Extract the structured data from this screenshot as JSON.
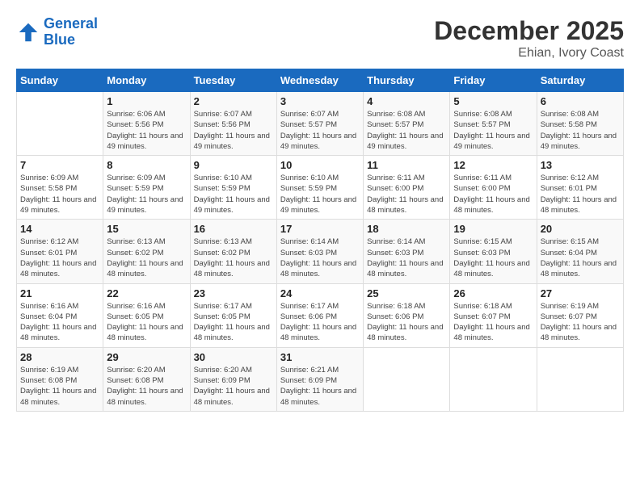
{
  "header": {
    "logo_line1": "General",
    "logo_line2": "Blue",
    "month": "December 2025",
    "location": "Ehian, Ivory Coast"
  },
  "days_of_week": [
    "Sunday",
    "Monday",
    "Tuesday",
    "Wednesday",
    "Thursday",
    "Friday",
    "Saturday"
  ],
  "weeks": [
    [
      {
        "day": "",
        "sunrise": "",
        "sunset": "",
        "daylight": ""
      },
      {
        "day": "1",
        "sunrise": "6:06 AM",
        "sunset": "5:56 PM",
        "daylight": "11 hours and 49 minutes."
      },
      {
        "day": "2",
        "sunrise": "6:07 AM",
        "sunset": "5:56 PM",
        "daylight": "11 hours and 49 minutes."
      },
      {
        "day": "3",
        "sunrise": "6:07 AM",
        "sunset": "5:57 PM",
        "daylight": "11 hours and 49 minutes."
      },
      {
        "day": "4",
        "sunrise": "6:08 AM",
        "sunset": "5:57 PM",
        "daylight": "11 hours and 49 minutes."
      },
      {
        "day": "5",
        "sunrise": "6:08 AM",
        "sunset": "5:57 PM",
        "daylight": "11 hours and 49 minutes."
      },
      {
        "day": "6",
        "sunrise": "6:08 AM",
        "sunset": "5:58 PM",
        "daylight": "11 hours and 49 minutes."
      }
    ],
    [
      {
        "day": "7",
        "sunrise": "6:09 AM",
        "sunset": "5:58 PM",
        "daylight": "11 hours and 49 minutes."
      },
      {
        "day": "8",
        "sunrise": "6:09 AM",
        "sunset": "5:59 PM",
        "daylight": "11 hours and 49 minutes."
      },
      {
        "day": "9",
        "sunrise": "6:10 AM",
        "sunset": "5:59 PM",
        "daylight": "11 hours and 49 minutes."
      },
      {
        "day": "10",
        "sunrise": "6:10 AM",
        "sunset": "5:59 PM",
        "daylight": "11 hours and 49 minutes."
      },
      {
        "day": "11",
        "sunrise": "6:11 AM",
        "sunset": "6:00 PM",
        "daylight": "11 hours and 48 minutes."
      },
      {
        "day": "12",
        "sunrise": "6:11 AM",
        "sunset": "6:00 PM",
        "daylight": "11 hours and 48 minutes."
      },
      {
        "day": "13",
        "sunrise": "6:12 AM",
        "sunset": "6:01 PM",
        "daylight": "11 hours and 48 minutes."
      }
    ],
    [
      {
        "day": "14",
        "sunrise": "6:12 AM",
        "sunset": "6:01 PM",
        "daylight": "11 hours and 48 minutes."
      },
      {
        "day": "15",
        "sunrise": "6:13 AM",
        "sunset": "6:02 PM",
        "daylight": "11 hours and 48 minutes."
      },
      {
        "day": "16",
        "sunrise": "6:13 AM",
        "sunset": "6:02 PM",
        "daylight": "11 hours and 48 minutes."
      },
      {
        "day": "17",
        "sunrise": "6:14 AM",
        "sunset": "6:03 PM",
        "daylight": "11 hours and 48 minutes."
      },
      {
        "day": "18",
        "sunrise": "6:14 AM",
        "sunset": "6:03 PM",
        "daylight": "11 hours and 48 minutes."
      },
      {
        "day": "19",
        "sunrise": "6:15 AM",
        "sunset": "6:03 PM",
        "daylight": "11 hours and 48 minutes."
      },
      {
        "day": "20",
        "sunrise": "6:15 AM",
        "sunset": "6:04 PM",
        "daylight": "11 hours and 48 minutes."
      }
    ],
    [
      {
        "day": "21",
        "sunrise": "6:16 AM",
        "sunset": "6:04 PM",
        "daylight": "11 hours and 48 minutes."
      },
      {
        "day": "22",
        "sunrise": "6:16 AM",
        "sunset": "6:05 PM",
        "daylight": "11 hours and 48 minutes."
      },
      {
        "day": "23",
        "sunrise": "6:17 AM",
        "sunset": "6:05 PM",
        "daylight": "11 hours and 48 minutes."
      },
      {
        "day": "24",
        "sunrise": "6:17 AM",
        "sunset": "6:06 PM",
        "daylight": "11 hours and 48 minutes."
      },
      {
        "day": "25",
        "sunrise": "6:18 AM",
        "sunset": "6:06 PM",
        "daylight": "11 hours and 48 minutes."
      },
      {
        "day": "26",
        "sunrise": "6:18 AM",
        "sunset": "6:07 PM",
        "daylight": "11 hours and 48 minutes."
      },
      {
        "day": "27",
        "sunrise": "6:19 AM",
        "sunset": "6:07 PM",
        "daylight": "11 hours and 48 minutes."
      }
    ],
    [
      {
        "day": "28",
        "sunrise": "6:19 AM",
        "sunset": "6:08 PM",
        "daylight": "11 hours and 48 minutes."
      },
      {
        "day": "29",
        "sunrise": "6:20 AM",
        "sunset": "6:08 PM",
        "daylight": "11 hours and 48 minutes."
      },
      {
        "day": "30",
        "sunrise": "6:20 AM",
        "sunset": "6:09 PM",
        "daylight": "11 hours and 48 minutes."
      },
      {
        "day": "31",
        "sunrise": "6:21 AM",
        "sunset": "6:09 PM",
        "daylight": "11 hours and 48 minutes."
      },
      {
        "day": "",
        "sunrise": "",
        "sunset": "",
        "daylight": ""
      },
      {
        "day": "",
        "sunrise": "",
        "sunset": "",
        "daylight": ""
      },
      {
        "day": "",
        "sunrise": "",
        "sunset": "",
        "daylight": ""
      }
    ]
  ]
}
